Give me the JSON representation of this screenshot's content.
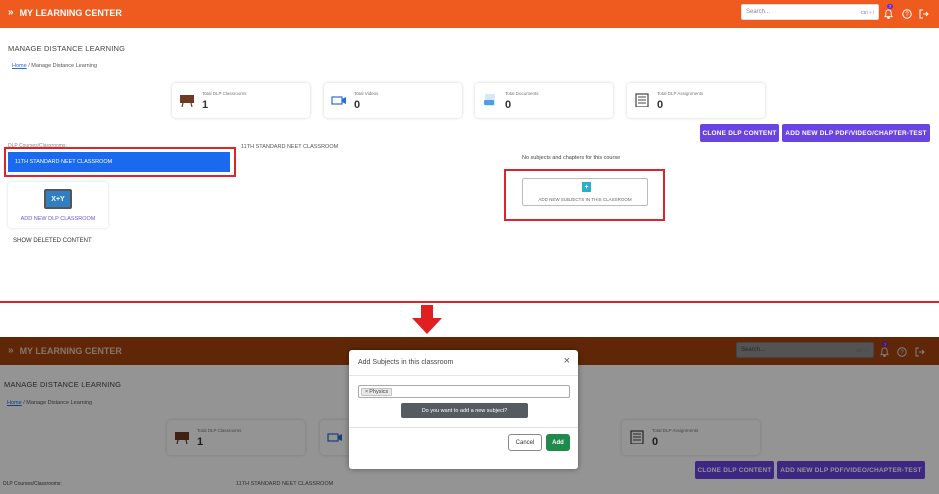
{
  "app": {
    "title": "MY LEARNING CENTER"
  },
  "search": {
    "placeholder": "Search...",
    "shortcut": "Ctrl + /"
  },
  "notifications": {
    "count": "7"
  },
  "page": {
    "title": "MANAGE DISTANCE LEARNING"
  },
  "breadcrumb": {
    "home": "Home",
    "separator": "/",
    "current": "Manage Distance Learning"
  },
  "stats": [
    {
      "label": "Total DLP Classrooms",
      "value": "1",
      "icon": "classroom-icon"
    },
    {
      "label": "Total Videos",
      "value": "0",
      "icon": "video-camera-icon"
    },
    {
      "label": "Total Documents",
      "value": "0",
      "icon": "pdf-document-icon"
    },
    {
      "label": "Total DLP Assignments",
      "value": "0",
      "icon": "assignment-icon"
    }
  ],
  "actions": {
    "clone": "CLONE DLP CONTENT",
    "add_new": "ADD NEW DLP PDF/VIDEO/CHAPTER-TEST"
  },
  "sidebar": {
    "label": "DLP Courses/Classrooms:",
    "selected_classroom": "11TH STANDARD NEET CLASSROOM",
    "add_card_icon_text": "X+Y",
    "add_classroom": "ADD NEW DLP CLASSROOM",
    "show_deleted": "SHOW DELETED CONTENT"
  },
  "main": {
    "heading": "11TH STANDARD NEET CLASSROOM",
    "empty_message": "No subjects and chapters for this course",
    "add_subjects_button": "ADD NEW SUBJECTS IN THIS CLASSROOM"
  },
  "modal": {
    "title": "Add Subjects in this classroom",
    "close_symbol": "×",
    "tag_remove": "×",
    "tag": "Physics",
    "tooltip": "Do you want to add a new subject?",
    "cancel": "Cancel",
    "add": "Add"
  },
  "colors": {
    "topbar": "#ef5a1e",
    "primary_button": "#6a44e0",
    "selected": "#1a6af0",
    "highlight": "#d9252b",
    "add_button": "#1f8a4c"
  }
}
